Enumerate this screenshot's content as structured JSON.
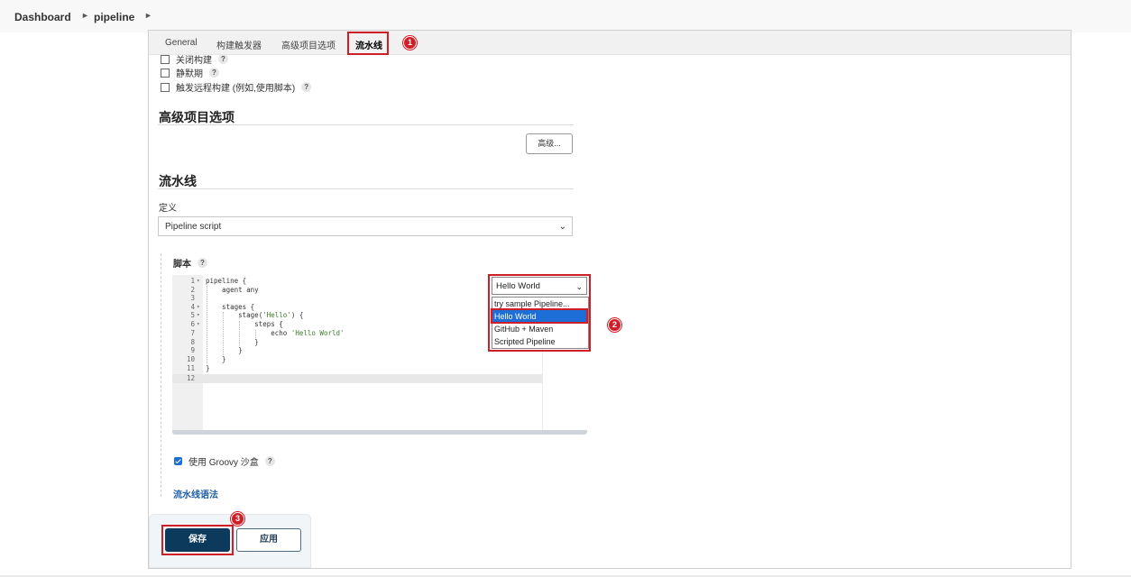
{
  "breadcrumb": {
    "items": [
      "Dashboard",
      "pipeline"
    ]
  },
  "tabs": [
    {
      "label": "General"
    },
    {
      "label": "构建触发器"
    },
    {
      "label": "高级项目选项"
    },
    {
      "label": "流水线",
      "active": true
    }
  ],
  "annotations": {
    "step1": "1",
    "step2": "2",
    "step3": "3",
    "color": "#d01e26"
  },
  "triggers": {
    "items": [
      "关闭构建",
      "静默期",
      "触发远程构建 (例如,使用脚本)"
    ],
    "help": "?"
  },
  "advanced": {
    "title": "高级项目选项",
    "button": "高级..."
  },
  "pipeline": {
    "title": "流水线",
    "definition_label": "定义",
    "definition_value": "Pipeline script",
    "script_label": "脚本",
    "script_help": "?",
    "sample_selected": "Hello World",
    "sample_options": [
      "try sample Pipeline...",
      "Hello World",
      "GitHub + Maven",
      "Scripted Pipeline"
    ],
    "sample_selected_index": 1,
    "line_numbers": [
      "1",
      "2",
      "3",
      "4",
      "5",
      "6",
      "7",
      "8",
      "9",
      "10",
      "11",
      "12"
    ],
    "code_lines": [
      "pipeline {",
      "    agent any",
      "",
      "    stages {",
      "        stage(",
      "            steps {",
      "                echo ",
      "            }",
      "        }",
      "    }",
      "}",
      ""
    ],
    "code_strings": [
      "'Hello'",
      "'Hello World'"
    ],
    "code_tails": [
      ") {"
    ],
    "groovy_label": "使用 Groovy 沙盒",
    "groovy_help": "?",
    "syntax_link": "流水线语法"
  },
  "footer": {
    "save": "保存",
    "apply": "应用"
  },
  "colors": {
    "primary": "#0b3a5c",
    "selection": "#1e6ed8",
    "link": "#1f5fa6"
  }
}
